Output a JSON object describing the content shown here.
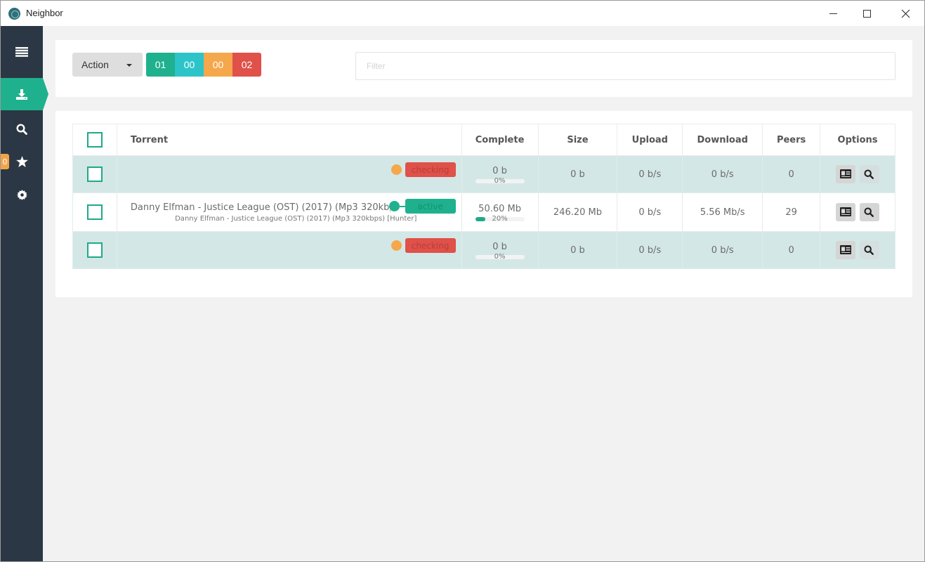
{
  "window": {
    "title": "Neighbor",
    "controls": {
      "minimize": "minimize",
      "maximize": "maximize",
      "close": "close"
    }
  },
  "sidebar": {
    "items": [
      {
        "name": "menu",
        "icon": "hamburger-icon",
        "active": false
      },
      {
        "name": "downloads",
        "icon": "download-icon",
        "active": true
      },
      {
        "name": "search",
        "icon": "search-icon",
        "active": false
      },
      {
        "name": "favorites",
        "icon": "star-icon",
        "active": false,
        "badge": "0"
      },
      {
        "name": "settings",
        "icon": "gear-icon",
        "active": false
      }
    ]
  },
  "toolbar": {
    "action_label": "Action",
    "counters": [
      {
        "name": "downloading",
        "value": "01",
        "color": "#1fb18e"
      },
      {
        "name": "seeding",
        "value": "00",
        "color": "#2cc4c9"
      },
      {
        "name": "paused",
        "value": "00",
        "color": "#f5a74c"
      },
      {
        "name": "error",
        "value": "02",
        "color": "#df5149"
      }
    ],
    "filter_placeholder": "Filter",
    "filter_value": ""
  },
  "table": {
    "columns": [
      "",
      "Torrent",
      "Complete",
      "Size",
      "Upload",
      "Download",
      "Peers",
      "Options"
    ],
    "rows": [
      {
        "name": "",
        "subname": "",
        "status": "checking",
        "status_color": "#df5149",
        "dot_color": "#f5a74c",
        "complete": "0 b",
        "percent": 0,
        "percent_label": "0%",
        "size": "0 b",
        "upload": "0 b/s",
        "download": "0 b/s",
        "peers": "0"
      },
      {
        "name": "Danny Elfman - Justice League (OST) (2017) (Mp3 320kbps) [Hunter]",
        "subname": "Danny Elfman - Justice League (OST) (2017) (Mp3 320kbps) [Hunter]",
        "status": "active",
        "status_color": "#1fb18e",
        "dot_color": "#1fb18e",
        "complete": "50.60 Mb",
        "percent": 20,
        "percent_label": "20%",
        "size": "246.20 Mb",
        "upload": "0 b/s",
        "download": "5.56 Mb/s",
        "peers": "29"
      },
      {
        "name": "",
        "subname": "",
        "status": "checking",
        "status_color": "#df5149",
        "dot_color": "#f5a74c",
        "complete": "0 b",
        "percent": 0,
        "percent_label": "0%",
        "size": "0 b",
        "upload": "0 b/s",
        "download": "0 b/s",
        "peers": "0"
      }
    ],
    "options": [
      "details-icon",
      "search-icon"
    ]
  }
}
